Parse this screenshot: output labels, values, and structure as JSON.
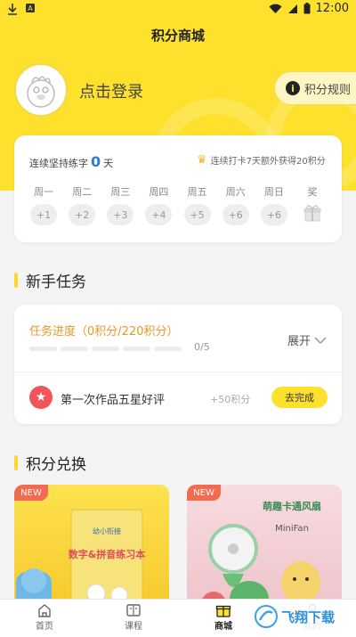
{
  "status_bar": {
    "time": "12:00"
  },
  "header": {
    "title": "积分商城",
    "login_text": "点击登录",
    "rules_button": "积分规则"
  },
  "checkin": {
    "streak_prefix": "连续坚持练字",
    "streak_days": "0",
    "streak_suffix": "天",
    "bonus_text": "连续打卡7天额外获得20积分",
    "days": [
      {
        "label": "周一",
        "points": "+1"
      },
      {
        "label": "周二",
        "points": "+2"
      },
      {
        "label": "周三",
        "points": "+3"
      },
      {
        "label": "周四",
        "points": "+4"
      },
      {
        "label": "周五",
        "points": "+5"
      },
      {
        "label": "周六",
        "points": "+6"
      },
      {
        "label": "周日",
        "points": "+6"
      }
    ],
    "reward_label": "奖"
  },
  "newbie_tasks": {
    "section_title": "新手任务",
    "progress_label": "任务进度（0积分/220积分）",
    "progress_count": "0/5",
    "progress_fraction": 0,
    "expand_label": "展开",
    "tasks": [
      {
        "name": "第一次作品五星好评",
        "points": "+50积分",
        "button": "去完成"
      }
    ]
  },
  "exchange": {
    "section_title": "积分兑换",
    "products": [
      {
        "badge": "NEW",
        "cover_text": "数字&拼音练习本",
        "cover_brand": "幼小衔接"
      },
      {
        "badge": "NEW",
        "cover_text": "萌趣卡通风扇",
        "cover_brand": "MiniFan"
      }
    ]
  },
  "tab_bar": {
    "tabs": [
      {
        "label": "首页",
        "icon": "home-icon"
      },
      {
        "label": "课程",
        "icon": "course-icon"
      },
      {
        "label": "商城",
        "icon": "gift-icon",
        "active": true
      },
      {
        "label": "我的",
        "icon": "profile-icon"
      }
    ]
  },
  "watermark": "飞翔下载"
}
